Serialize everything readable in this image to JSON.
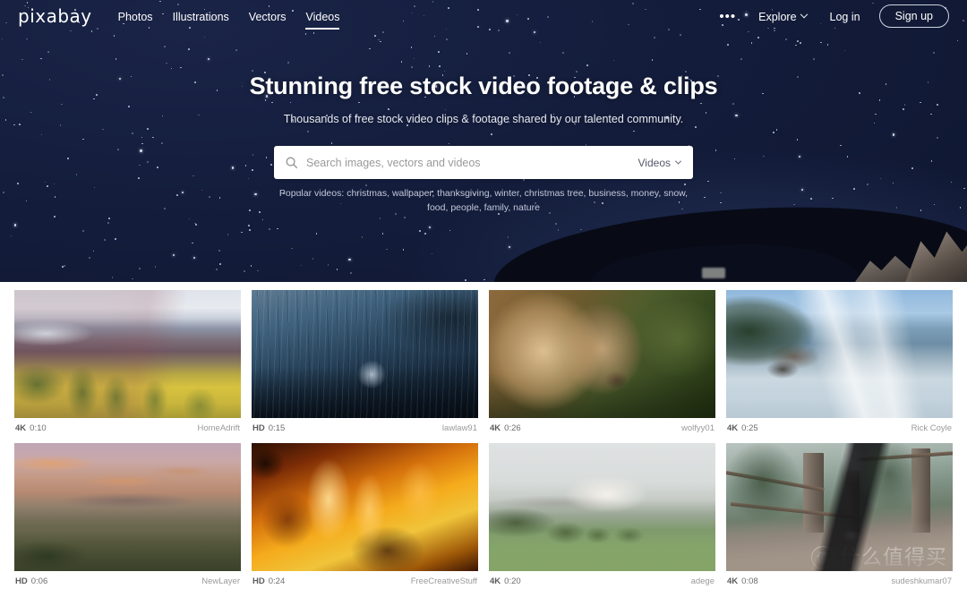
{
  "brand": {
    "name": "pixabay"
  },
  "nav": {
    "links": [
      {
        "label": "Photos",
        "active": false
      },
      {
        "label": "Illustrations",
        "active": false
      },
      {
        "label": "Vectors",
        "active": false
      },
      {
        "label": "Videos",
        "active": true
      }
    ],
    "more_icon": "•••",
    "explore_label": "Explore",
    "login_label": "Log in",
    "signup_label": "Sign up"
  },
  "hero": {
    "title": "Stunning free stock video footage & clips",
    "subtitle": "Thousands of free stock video clips & footage shared by our talented community.",
    "search": {
      "value": "",
      "placeholder": "Search images, vectors and videos",
      "type_label": "Videos",
      "icon": "search-icon"
    },
    "popular_prefix": "Popular videos:",
    "popular_tags": "christmas, wallpaper, thanksgiving, winter, christmas tree, business, money, snow, food, people, family, nature"
  },
  "videos": [
    {
      "quality": "4K",
      "duration": "0:10",
      "user": "HomeAdrift",
      "art": "t-valley"
    },
    {
      "quality": "HD",
      "duration": "0:15",
      "user": "lawlaw91",
      "art": "t-rain"
    },
    {
      "quality": "4K",
      "duration": "0:26",
      "user": "wolfyy01",
      "art": "t-wolf"
    },
    {
      "quality": "4K",
      "duration": "0:25",
      "user": "Rick  Coyle",
      "art": "t-coast"
    },
    {
      "quality": "HD",
      "duration": "0:06",
      "user": "NewLayer",
      "art": "t-sunset"
    },
    {
      "quality": "HD",
      "duration": "0:24",
      "user": "FreeCreativeStuff",
      "art": "t-fire"
    },
    {
      "quality": "4K",
      "duration": "0:20",
      "user": "adege",
      "art": "t-mist"
    },
    {
      "quality": "4K",
      "duration": "0:08",
      "user": "sudeshkumar07",
      "art": "t-runner"
    }
  ],
  "watermark": {
    "mark": "值",
    "text": "什么值得买"
  },
  "colors": {
    "hero_bg": "#131d3a",
    "page_bg": "#ffffff",
    "nav_text": "#ffffff",
    "meta_text": "#8b8b8b"
  }
}
